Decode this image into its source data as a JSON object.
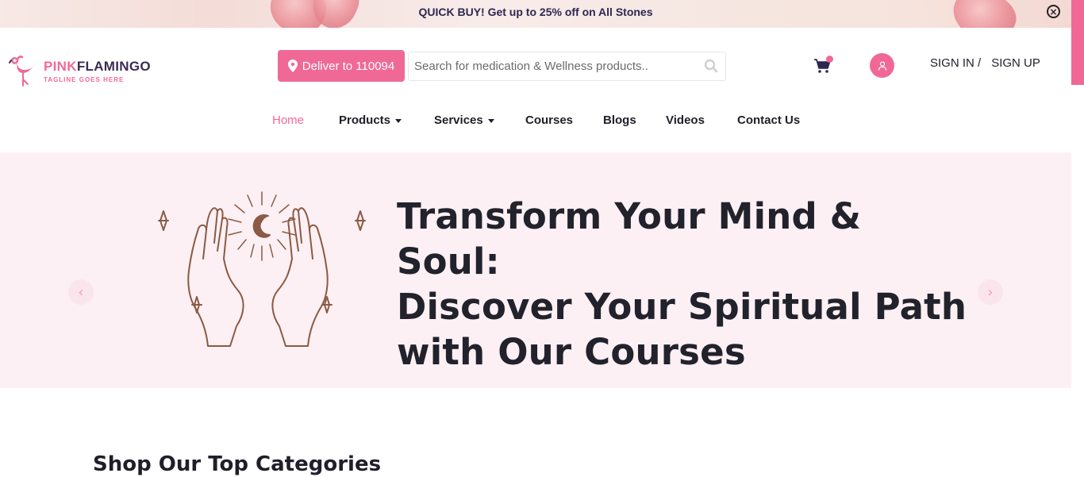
{
  "promo": {
    "text": "QUICK BUY! Get up to 25% off on All Stones",
    "close_glyph": "×"
  },
  "header": {
    "logo_pink": "PINK",
    "logo_dark": "FLAMINGO",
    "tagline": "TAGLINE GOES HERE",
    "deliver_label": "Deliver to 110094",
    "search_placeholder": "Search for medication & Wellness products..",
    "signin_label": "SIGN IN /",
    "signup_label": "SIGN UP"
  },
  "nav": {
    "items": [
      {
        "label": "Home"
      },
      {
        "label": "Products"
      },
      {
        "label": "Services"
      },
      {
        "label": "Courses"
      },
      {
        "label": "Blogs"
      },
      {
        "label": "Videos"
      },
      {
        "label": "Contact Us"
      }
    ]
  },
  "hero": {
    "line1": "Transform Your Mind & Soul:",
    "line2": "Discover Your Spiritual Path",
    "line3": "with Our Courses",
    "prev_glyph": "‹",
    "next_glyph": "›"
  },
  "sections": {
    "categories_title": "Shop Our Top Categories"
  },
  "colors": {
    "accent": "#f06996",
    "hero_bg": "#fdf0f4",
    "text_dark": "#1f1f2b",
    "illustration": "#8a5a44"
  },
  "icons": [
    "close-icon",
    "flamingo-logo-icon",
    "location-pin-icon",
    "search-icon",
    "cart-icon",
    "user-icon",
    "caret-down-icon",
    "chevron-left-icon",
    "chevron-right-icon"
  ]
}
